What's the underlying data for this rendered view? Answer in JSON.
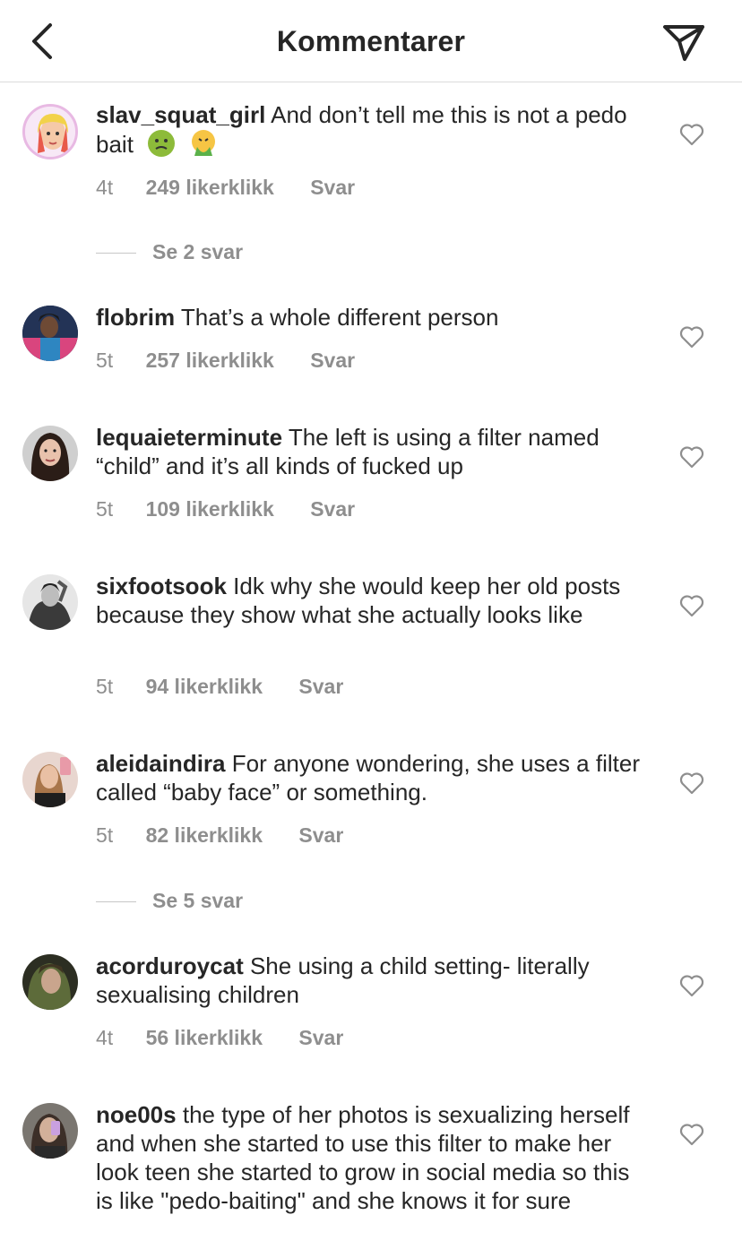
{
  "header": {
    "title": "Kommentarer"
  },
  "colors": {
    "text": "#262626",
    "muted": "#8e8e8e",
    "divider": "#dbdbdb"
  },
  "comments": [
    {
      "username": "slav_squat_girl",
      "text": "And don’t tell me this is not a pedo bait",
      "emojis": [
        "nauseated-face-emoji",
        "vomiting-face-emoji"
      ],
      "time": "4t",
      "likes": "249 likerklikk",
      "reply": "Svar",
      "view_replies": "Se 2 svar"
    },
    {
      "username": "flobrim",
      "text": "That’s a whole different person",
      "time": "5t",
      "likes": "257 likerklikk",
      "reply": "Svar"
    },
    {
      "username": "lequaieterminute",
      "text": "The left is using a filter named “child” and it’s all kinds of fucked up",
      "time": "5t",
      "likes": "109 likerklikk",
      "reply": "Svar"
    },
    {
      "username": "sixfootsook",
      "text": "Idk why she would keep her old posts because they show what she actually looks like",
      "time": "5t",
      "likes": "94 likerklikk",
      "reply": "Svar"
    },
    {
      "username": "aleidaindira",
      "text": "For anyone wondering, she uses a filter called “baby face” or something.",
      "time": "5t",
      "likes": "82 likerklikk",
      "reply": "Svar",
      "view_replies": "Se 5 svar"
    },
    {
      "username": "acorduroycat",
      "text": "She using a child setting- literally sexualising children",
      "time": "4t",
      "likes": "56 likerklikk",
      "reply": "Svar"
    },
    {
      "username": "noe00s",
      "text": "the type of her photos is sexualizing herself and when she started to use this filter to make her look teen she started to grow in social media so this is like \"pedo-baiting\" and she knows it for sure"
    }
  ]
}
